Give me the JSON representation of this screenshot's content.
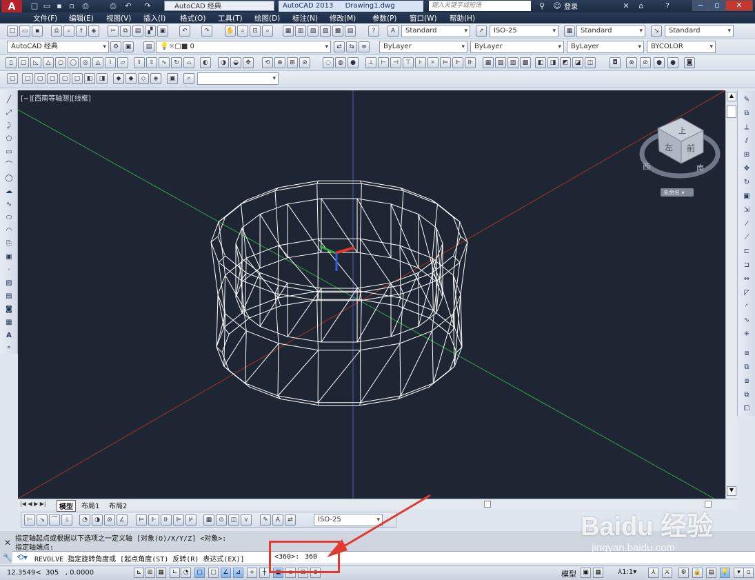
{
  "titlebar": {
    "logo": "A",
    "workspace": "AutoCAD 经典",
    "app_name": "AutoCAD 2013",
    "document": "Drawing1.dwg",
    "search_placeholder": "键入关键字或短语",
    "login": "登录"
  },
  "menu": [
    "文件(F)",
    "编辑(E)",
    "视图(V)",
    "插入(I)",
    "格式(O)",
    "工具(T)",
    "绘图(D)",
    "标注(N)",
    "修改(M)",
    "参数(P)",
    "窗口(W)",
    "帮助(H)"
  ],
  "styles": {
    "text_style": "Standard",
    "dim_style": "ISO-25",
    "table_style": "Standard",
    "mleader_style": "Standard"
  },
  "layers": {
    "workspace": "AutoCAD 经典",
    "layer": "0",
    "color": "ByLayer",
    "linetype": "ByLayer",
    "lineweight": "ByLayer",
    "plotstyle": "BYCOLOR"
  },
  "viewport": {
    "label": "[−][西南等轴测][线框]",
    "viewcube_top": "上",
    "viewcube_front": "左",
    "viewcube_right": "前",
    "compass_west": "西",
    "compass_south": "南",
    "ucs_label": "未命名 ▾"
  },
  "layout_tabs": [
    "模型",
    "布局1",
    "布局2"
  ],
  "dim_toolbar": {
    "style": "ISO-25"
  },
  "command": {
    "history": [
      "指定轴起点或根据以下选项之一定义轴 [对象(O)/X/Y/Z] <对象>:",
      "指定轴端点:"
    ],
    "current_prefix": "REVOLVE 指定旋转角度或 [起点角度(ST) 反转(R) 表达式(EX)]",
    "current_default": "<360>:",
    "current_value": "360"
  },
  "status": {
    "coords": "12.3549<  305   , 0.0000",
    "model_label": "模型",
    "annotation_scale": "1:1"
  },
  "watermark": {
    "main": "Baidu 经验",
    "sub": "jingyan.baidu.com"
  },
  "colors": {
    "viewport_bg": "#1f2633",
    "wire": "#ffffff",
    "axis_x": "#c0392b",
    "axis_y": "#27ae3a",
    "axis_z": "#4a56c8",
    "highlight": "#e23a2f"
  }
}
